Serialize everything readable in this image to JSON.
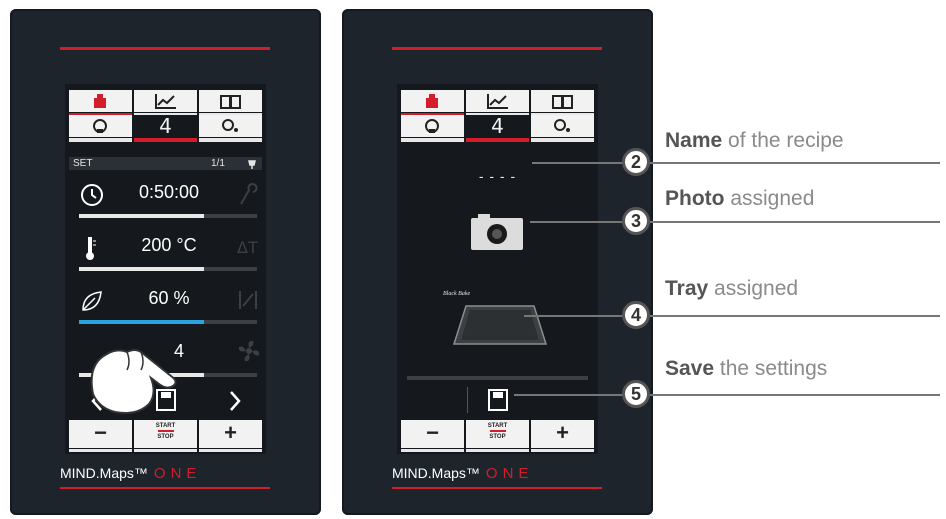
{
  "panel1": {
    "status": {
      "label": "SET",
      "page": "1/1"
    },
    "tab_digit": "4",
    "rows": [
      {
        "value": "0:50:00",
        "progress": 0.7
      },
      {
        "value": "200 °C",
        "progress": 0.7
      },
      {
        "value": "60 %",
        "progress": 0.7
      },
      {
        "value": "4",
        "progress": 0.7
      }
    ],
    "nav_next": "›",
    "start": "START",
    "stop": "STOP",
    "minus": "−",
    "plus": "+"
  },
  "panel2": {
    "tab_digit": "4",
    "recipe_name": "- - - -",
    "tray_caption": "Black Bake",
    "start": "START",
    "stop": "STOP",
    "minus": "−",
    "plus": "+"
  },
  "brand": {
    "name": "MIND.Maps™",
    "edition": "ONE"
  },
  "callouts": [
    {
      "num": "2",
      "bold": "Name",
      "rest": " of the recipe"
    },
    {
      "num": "3",
      "bold": "Photo",
      "rest": " assigned"
    },
    {
      "num": "4",
      "bold": "Tray",
      "rest": " assigned"
    },
    {
      "num": "5",
      "bold": "Save",
      "rest": " the settings"
    }
  ],
  "colors": {
    "accent": "#d31d2b",
    "panel": "#1d242b",
    "screen": "#15191d",
    "humidity": "#2aa3e0"
  }
}
